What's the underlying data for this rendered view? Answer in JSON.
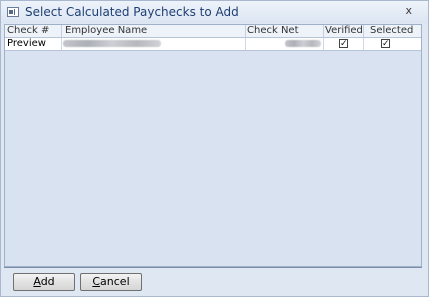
{
  "window": {
    "title": "Select Calculated Paychecks to Add",
    "close_glyph": "x",
    "icon": "app-window-icon"
  },
  "grid": {
    "columns": {
      "check_no": "Check #",
      "employee_name": "Employee Name",
      "check_net": "Check Net",
      "verified": "Verified",
      "selected": "Selected"
    },
    "rows": [
      {
        "check_no": "Preview",
        "employee_name": "",
        "check_net": "",
        "verified": true,
        "selected": true
      }
    ]
  },
  "footer": {
    "add_label_accesskey": "A",
    "add_label_rest": "dd",
    "cancel_label_accesskey": "C",
    "cancel_label_rest": "ancel"
  },
  "colors": {
    "title_text": "#1f3f73",
    "window_bg": "#dfe7f2",
    "grid_bg": "#d8e2f0"
  }
}
